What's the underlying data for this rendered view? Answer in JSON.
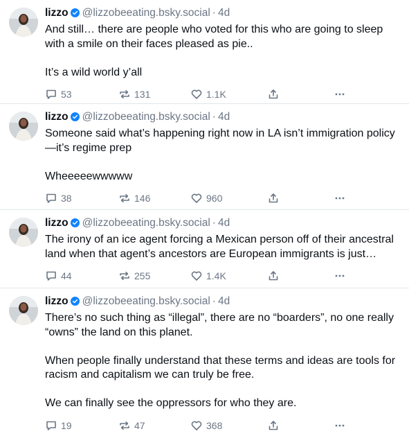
{
  "posts": [
    {
      "author": "lizzo",
      "handle": "@lizzobeeating.bsky.social",
      "separator": "·",
      "time": "4d",
      "text": "And still… there are people who voted for this who are going to sleep with a smile on their faces pleased as pie..\n\nIt’s a wild world y’all",
      "replies": "53",
      "reposts": "131",
      "likes": "1.1K"
    },
    {
      "author": "lizzo",
      "handle": "@lizzobeeating.bsky.social",
      "separator": "·",
      "time": "4d",
      "text": "Someone said what’s happening right now in LA isn’t immigration policy —it’s regime prep\n\nWheeeeewwwww",
      "replies": "38",
      "reposts": "146",
      "likes": "960"
    },
    {
      "author": "lizzo",
      "handle": "@lizzobeeating.bsky.social",
      "separator": "·",
      "time": "4d",
      "text": "The irony of an ice agent forcing a Mexican person off of their ancestral land when that agent’s ancestors are European immigrants is just…",
      "replies": "44",
      "reposts": "255",
      "likes": "1.4K"
    },
    {
      "author": "lizzo",
      "handle": "@lizzobeeating.bsky.social",
      "separator": "·",
      "time": "4d",
      "text": "There’s no such thing as “illegal”, there are no “boarders”, no one really “owns” the land on this planet.\n\nWhen people finally understand that these terms and ideas are tools for racism and capitalism we can truly be free.\n\nWe can finally see the oppressors for who they are.",
      "replies": "19",
      "reposts": "47",
      "likes": "368"
    }
  ],
  "icons": {
    "verified": "verified-badge-icon",
    "reply": "speech-bubble-icon",
    "repost": "repost-arrows-icon",
    "like": "heart-icon",
    "share": "share-arrow-icon",
    "more": "ellipsis-icon"
  },
  "colors": {
    "verified": "#1083fe",
    "text": "#0b0f14",
    "muted": "#6b7684",
    "divider": "#e3e7ec"
  }
}
